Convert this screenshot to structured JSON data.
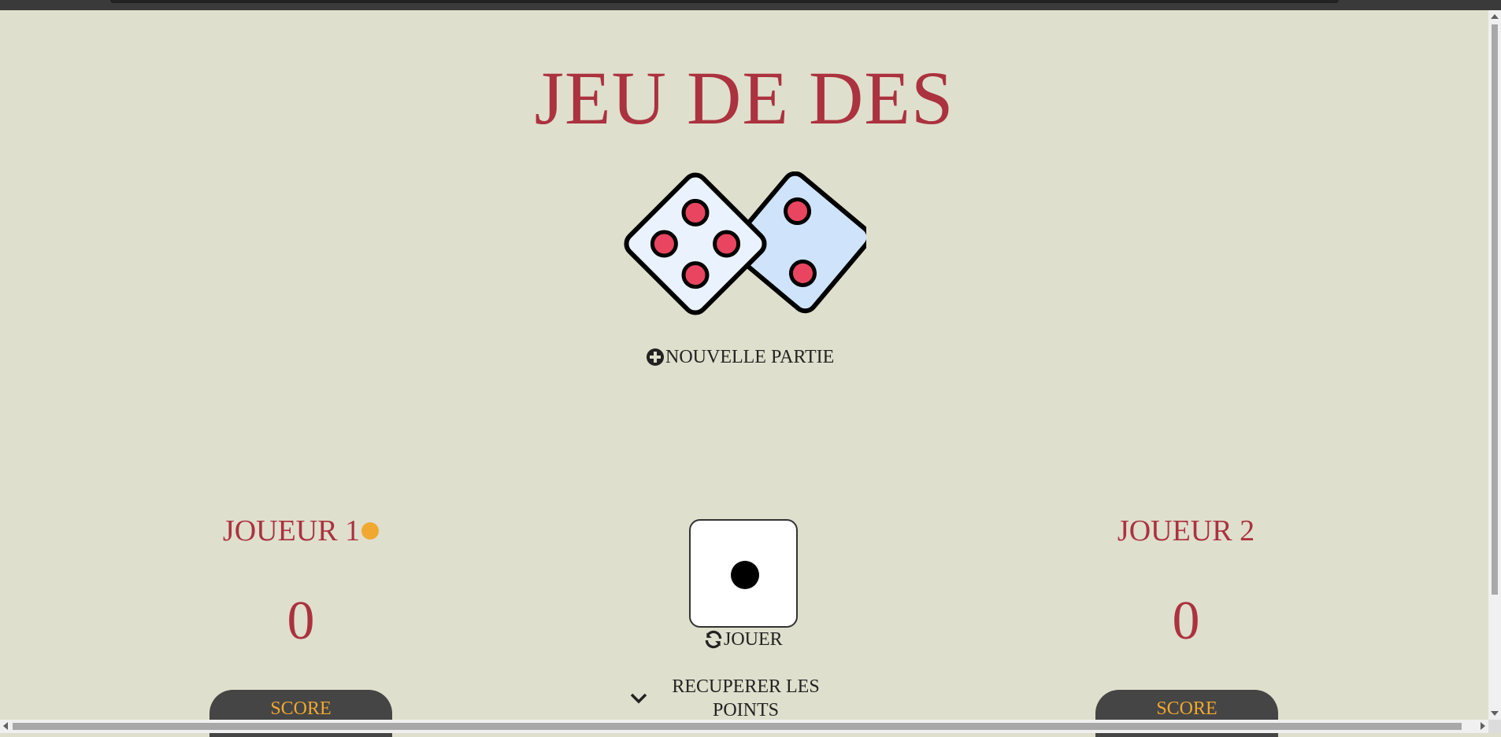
{
  "game": {
    "title": "JEU DE DES",
    "new_game_label": "NOUVELLE PARTIE",
    "play_label": "JOUER",
    "hold_label": "RECUPERER LES POINTS",
    "current_die_value": 1
  },
  "players": [
    {
      "name": "JOUEUR 1",
      "global_score": "0",
      "score_label": "SCORE",
      "active": true
    },
    {
      "name": "JOUEUR 2",
      "global_score": "0",
      "score_label": "SCORE",
      "active": false
    }
  ],
  "colors": {
    "background": "#dfdfcd",
    "accent": "#ab323f",
    "active_indicator": "#f0a830",
    "score_button": "#454545"
  },
  "icons": {
    "new_game": "plus-circle-icon",
    "play": "refresh-icon",
    "hold": "chevron-down-icon",
    "logo": "dice-pair-icon"
  }
}
